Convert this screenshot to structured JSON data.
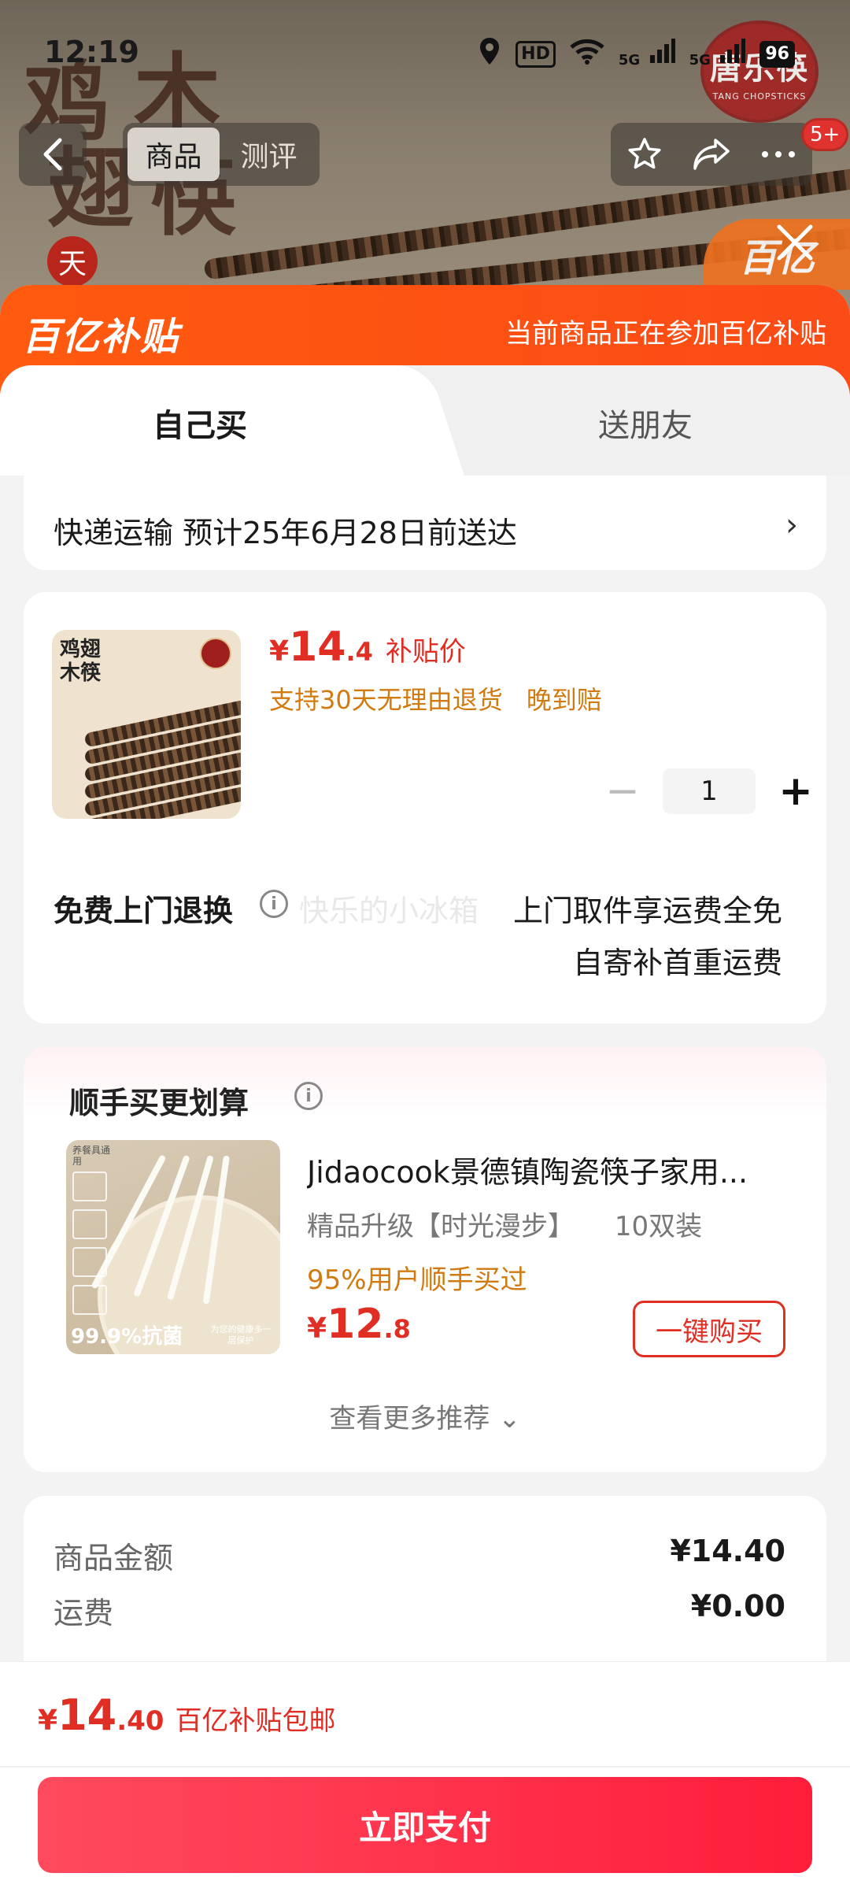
{
  "status_bar": {
    "time": "12:19",
    "hd_label": "HD",
    "net_label_1": "5G",
    "net_label_2": "5G",
    "battery_label": "96"
  },
  "nav": {
    "tabs": [
      {
        "label": "商品",
        "active": true
      },
      {
        "label": "测评",
        "active": false
      }
    ],
    "badge": "5+"
  },
  "banner": {
    "calligraphy": [
      "鸡",
      "翅",
      "木",
      "筷"
    ],
    "seal_char": "天",
    "brand_cn": "唐乐筷",
    "brand_en": "TANG CHOPSTICKS",
    "corner_logo": "百亿"
  },
  "subsidy_header": {
    "logo": "百亿补贴",
    "note": "当前商品正在参加百亿补贴"
  },
  "segment": {
    "buy_self": "自己买",
    "gift_friend": "送朋友"
  },
  "delivery": {
    "text": "快递运输 预计25年6月28日前送达",
    "chevron": "›"
  },
  "product": {
    "image_text": [
      "鸡翅",
      "木筷"
    ],
    "price_currency": "¥",
    "price_int": "14",
    "price_dec": ".4",
    "price_label": "补贴价",
    "guarantees": [
      "支持30天无理由退货",
      "晚到赔"
    ],
    "quantity": "1",
    "minus": "−",
    "plus": "+"
  },
  "return_service": {
    "title": "免费上门退换",
    "info_icon": "i",
    "watermark": "快乐的小冰箱",
    "line1": "上门取件享运费全免",
    "line2": "自寄补首重运费"
  },
  "bundle": {
    "title": "顺手买更划算",
    "info_icon": "i",
    "image_badge": "99.9%抗菌",
    "image_tag": "养餐具通用",
    "image_foot": "为您的健康多一层保护",
    "name": "Jidaocook景德镇陶瓷筷子家用...",
    "spec": [
      "精品升级【时光漫步】",
      "10双装"
    ],
    "social": "95%用户顺手买过",
    "price_currency": "¥",
    "price_int": "12",
    "price_dec": ".8",
    "buy_label": "一键购买",
    "more_label": "查看更多推荐 ⌄"
  },
  "totals": {
    "rows": [
      {
        "label": "商品金额",
        "value": "¥14.40"
      },
      {
        "label": "运费",
        "value": "¥0.00"
      }
    ]
  },
  "bottom_bar": {
    "price_currency": "¥",
    "price_int": "14",
    "price_dec": ".40",
    "price_label": "百亿补贴包邮",
    "pay_label": "立即支付"
  },
  "colors": {
    "subsidy_orange": "#ff5a0f",
    "price_red": "#e02e24",
    "pay_button": "#ff1d3a",
    "guarantee_orange": "#d17a10"
  }
}
